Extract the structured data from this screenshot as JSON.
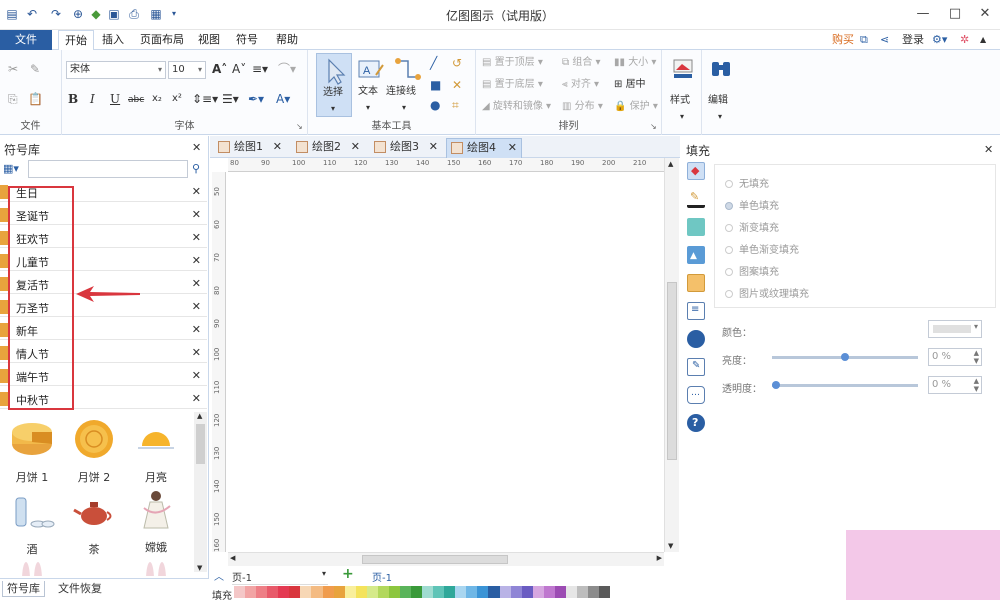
{
  "app": {
    "title": "亿图图示（试用版）"
  },
  "window_controls": {
    "minimize": "—",
    "maximize": "□",
    "close": "✕"
  },
  "menu": {
    "file": "文件",
    "tabs": [
      "开始",
      "插入",
      "页面布局",
      "视图",
      "符号",
      "帮助"
    ],
    "active_tab": "开始",
    "right": {
      "buy": "购买",
      "login": "登录"
    }
  },
  "ribbon": {
    "groups": {
      "file": "文件",
      "font": "字体",
      "basic_tools": "基本工具",
      "arrange": "排列"
    },
    "font_name": "宋体",
    "font_size": "10",
    "tools": {
      "select": "选择",
      "text": "文本",
      "connector": "连接线"
    },
    "arrange": {
      "bring_front": "置于顶层",
      "send_back": "置于底层",
      "rotate_mirror": "旋转和镜像",
      "group": "组合",
      "align": "对齐",
      "distribute": "分布",
      "size": "大小",
      "center": "居中",
      "protect": "保护"
    },
    "style": "样式",
    "edit": "编辑"
  },
  "symbol_library": {
    "title": "符号库",
    "categories": [
      "生日",
      "圣诞节",
      "狂欢节",
      "儿童节",
      "复活节",
      "万圣节",
      "新年",
      "情人节",
      "端午节",
      "中秋节"
    ],
    "shapes": [
      "月饼 1",
      "月饼 2",
      "月亮",
      "酒",
      "茶",
      "嫦娥"
    ],
    "bottom_tabs": [
      "符号库",
      "文件恢复"
    ]
  },
  "documents": {
    "tabs": [
      "绘图1",
      "绘图2",
      "绘图3",
      "绘图4"
    ],
    "active": "绘图4"
  },
  "rulers": {
    "h": [
      "80",
      "90",
      "100",
      "110",
      "120",
      "130",
      "140",
      "150",
      "160",
      "170",
      "180",
      "190",
      "200",
      "210"
    ],
    "v": [
      "50",
      "60",
      "70",
      "80",
      "90",
      "100",
      "110",
      "120",
      "130",
      "140",
      "150",
      "160"
    ]
  },
  "pages": {
    "page_label": "页-1",
    "current": "页-1"
  },
  "palette_label": "填充",
  "fill_panel": {
    "title": "填充",
    "options": [
      "无填充",
      "单色填充",
      "渐变填充",
      "单色渐变填充",
      "图案填充",
      "图片或纹理填充"
    ],
    "selected": "单色填充",
    "color_label": "颜色：",
    "brightness_label": "亮度：",
    "transparency_label": "透明度：",
    "brightness_value": "0 %",
    "transparency_value": "0 %",
    "brightness_level": 0.5,
    "transparency_level": 0.0
  },
  "colors": {
    "accent": "#2a5ea3",
    "highlight_red": "#d9363e",
    "category_marker": "#e8a33d"
  }
}
